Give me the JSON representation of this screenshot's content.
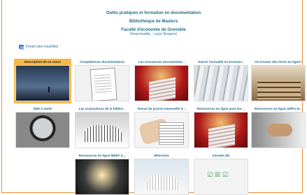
{
  "header": {
    "line1": "Outils pratiques et formation en documentation",
    "line2": "Bibliothèque de Masters",
    "line3": "Faculté d'économie de Grenoble",
    "responsable": "Responsable : Laure Bergerot"
  },
  "forum": {
    "label": "Forum des nouvelles",
    "icon": "forum-icon"
  },
  "tiles": [
    {
      "label": "Description de ce cours",
      "active": true
    },
    {
      "label": "Compétences documentaires"
    },
    {
      "label": "Les ressources documentair..."
    },
    {
      "label": "Suivre l'actualité en économ..."
    },
    {
      "label": "Où trouver des livres en ligne?"
    },
    {
      "label": "Web à outils"
    },
    {
      "label": "Les acquisitions de la bibliot..."
    },
    {
      "label": "Revue de presse mensuelle d..."
    },
    {
      "label": "Ressources en ligne pour les ..."
    },
    {
      "label": "Ressources en ligne UdPro R..."
    },
    {
      "label": "Ressources en ligne MEEF S..."
    },
    {
      "label": "Mémoires"
    },
    {
      "label": "Annales M1"
    }
  ],
  "colors": {
    "accent": "#f5b84a",
    "link": "#1d6c8c",
    "frame": "#e88b3a"
  }
}
